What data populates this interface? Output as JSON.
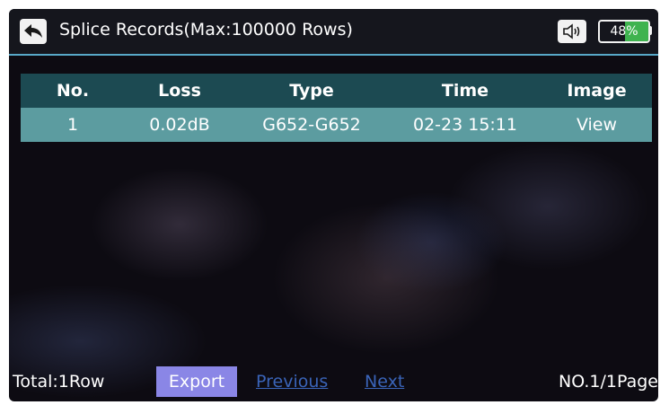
{
  "header": {
    "title": "Splice Records(Max:100000 Rows)",
    "back_icon": "back-arrow-icon",
    "sound_icon": "speaker-icon",
    "battery": {
      "percent": 48,
      "label": "48%"
    }
  },
  "table": {
    "columns": [
      "No.",
      "Loss",
      "Type",
      "Time",
      "Image"
    ],
    "rows": [
      [
        "1",
        "0.02dB",
        "G652-G652",
        "02-23 15:11",
        "View"
      ]
    ]
  },
  "footer": {
    "total": "Total:1Row",
    "export_label": "Export",
    "previous_label": "Previous",
    "next_label": "Next",
    "page_info": "NO.1/1Page"
  },
  "colors": {
    "header_row": "#1c4a52",
    "data_row": "#5c9ca0",
    "accent_line": "#58a8c8",
    "export_button": "#8a86e6",
    "link": "#3a64b8",
    "battery_fill": "#3fb34f"
  }
}
